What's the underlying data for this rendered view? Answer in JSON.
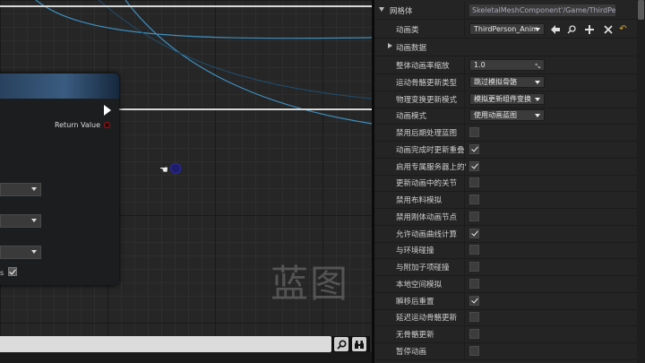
{
  "graph": {
    "node": {
      "return_label": "Return Value",
      "checkbox_label_fragment": "s",
      "checkbox_checked": true
    },
    "watermark": "蓝图"
  },
  "details": {
    "section_header": "网格体",
    "path_value": "SkeletalMeshComponent'/Game/ThirdPer",
    "anim_class": {
      "label": "动画类",
      "value": "ThirdPerson_Anim"
    },
    "anim_data": {
      "label": "动画数据"
    },
    "rows": [
      {
        "label": "整体动画率缩放",
        "type": "number",
        "value": "1.0"
      },
      {
        "label": "运动骨骼更新类型",
        "type": "dropdown",
        "value": "跳过模拟骨骼"
      },
      {
        "label": "物理变换更新模式",
        "type": "dropdown",
        "value": "模拟更新组件变换"
      },
      {
        "label": "动画模式",
        "type": "dropdown",
        "value": "使用动画蓝图"
      },
      {
        "label": "禁用后期处理蓝图",
        "type": "checkbox",
        "checked": false
      },
      {
        "label": "动画完成时更新重叠",
        "type": "checkbox",
        "checked": true
      },
      {
        "label": "启用专属服务器上的'",
        "type": "checkbox",
        "checked": true
      },
      {
        "label": "更新动画中的关节",
        "type": "checkbox",
        "checked": false
      },
      {
        "label": "禁用布料模拟",
        "type": "checkbox",
        "checked": false
      },
      {
        "label": "禁用刚体动画节点",
        "type": "checkbox",
        "checked": false
      },
      {
        "label": "允许动画曲线计算",
        "type": "checkbox",
        "checked": true
      },
      {
        "label": "与环境碰撞",
        "type": "checkbox",
        "checked": false
      },
      {
        "label": "与附加子项碰撞",
        "type": "checkbox",
        "checked": false
      },
      {
        "label": "本地空间模拟",
        "type": "checkbox",
        "checked": false
      },
      {
        "label": "瞬移后重置",
        "type": "checkbox",
        "checked": true
      },
      {
        "label": "延迟运动骨骼更新",
        "type": "checkbox",
        "checked": false
      },
      {
        "label": "无骨骼更新",
        "type": "checkbox",
        "checked": false
      },
      {
        "label": "暂停动画",
        "type": "checkbox",
        "checked": false
      }
    ]
  },
  "icons": {
    "search": "search-icon",
    "binoculars": "binoculars-icon",
    "use_selected": "arrow-left-icon",
    "browse": "browse-icon",
    "add": "plus-icon",
    "clear": "close-icon",
    "reset": "reset-to-default-icon"
  },
  "colors": {
    "wire_curve": "#3d8fbf",
    "exec_wire": "#ffffff",
    "pin_red": "#a01818",
    "node_header": "#3a5c80",
    "panel_bg": "#242424"
  }
}
